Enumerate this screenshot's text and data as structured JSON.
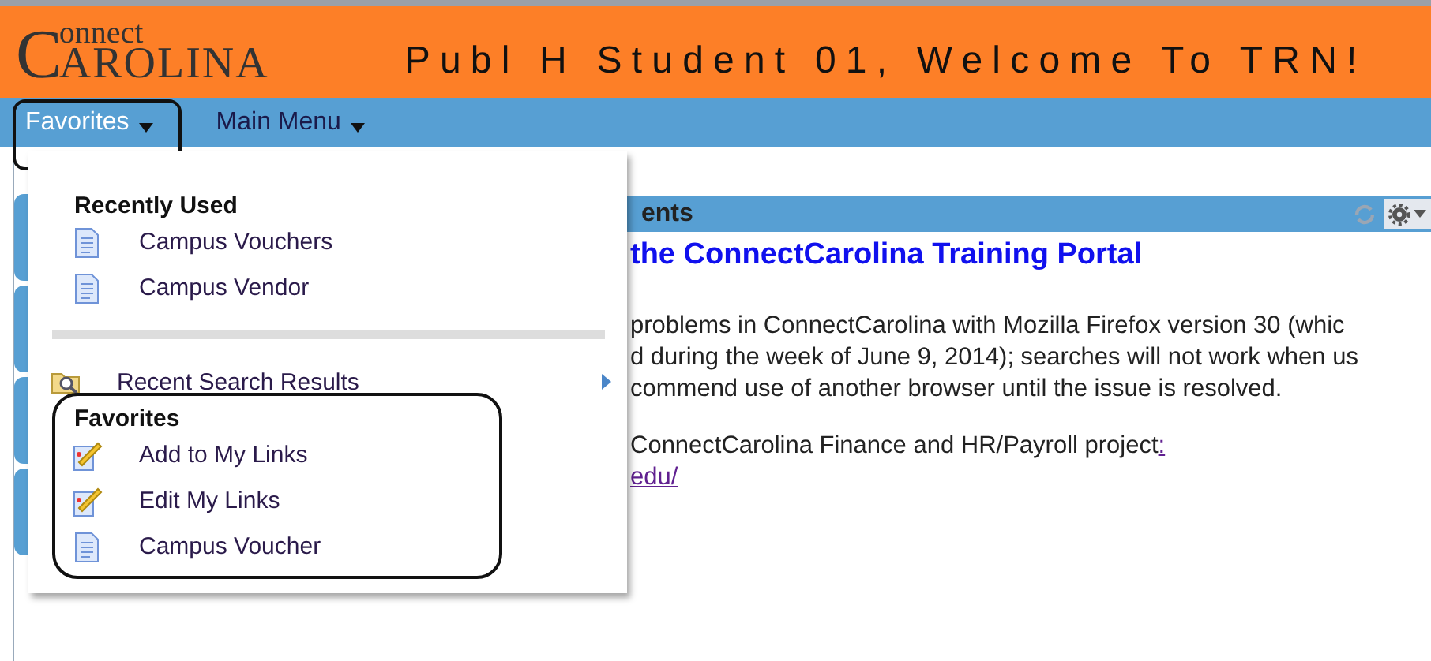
{
  "header": {
    "logo": {
      "initial": "C",
      "top": "onnect",
      "bottom": "AROLINA"
    },
    "welcome": "Publ H Student 01, Welcome To TRN!"
  },
  "nav": [
    {
      "label": "Favorites",
      "selected": true,
      "highlighted": true
    },
    {
      "label": "Main Menu",
      "selected": false,
      "highlighted": false
    }
  ],
  "dropdown": {
    "sections": [
      {
        "title": "Recently Used",
        "highlighted": false,
        "items": [
          {
            "label": "Campus Vouchers",
            "kind": "page"
          },
          {
            "label": "Campus Vendor",
            "kind": "page"
          }
        ]
      },
      {
        "kind": "submenu",
        "label": "Recent Search Results"
      },
      {
        "title": "Favorites",
        "highlighted": true,
        "items": [
          {
            "label": "Add to My Links",
            "kind": "edit"
          },
          {
            "label": "Edit My Links",
            "kind": "edit"
          },
          {
            "label": "Campus Voucher",
            "kind": "page"
          }
        ]
      }
    ]
  },
  "panel": {
    "title": "ents",
    "heading": "the ConnectCarolina Training Portal",
    "lines": [
      "problems in ConnectCarolina with Mozilla Firefox version 30 (whic",
      "d during the week of June 9, 2014); searches will not work when us",
      "commend use of another browser until the issue is resolved."
    ],
    "project_line": "ConnectCarolina Finance and HR/Payroll project",
    "project_link": ":",
    "url": "edu/"
  }
}
